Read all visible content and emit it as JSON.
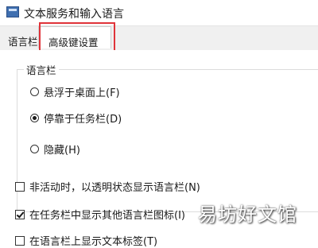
{
  "window": {
    "title": "文本服务和输入语言"
  },
  "tabs": [
    {
      "label": "语言栏"
    },
    {
      "label": "高级键设置"
    }
  ],
  "language_bar": {
    "group_label": "语言栏",
    "options": [
      {
        "label": "悬浮于桌面上(F)",
        "selected": false
      },
      {
        "label": "停靠于任务栏(D)",
        "selected": true
      },
      {
        "label": "隐藏(H)",
        "selected": false
      }
    ]
  },
  "checkboxes": [
    {
      "label": "非活动时，以透明状态显示语言栏(N)",
      "checked": false
    },
    {
      "label": "在任务栏中显示其他语言栏图标(I)",
      "checked": true
    },
    {
      "label": "在语言栏上显示文本标签(T)",
      "checked": false
    }
  ],
  "watermark": "易坊好文馆",
  "colors": {
    "highlight": "#e0343a",
    "accent": "#3f6fb0"
  }
}
